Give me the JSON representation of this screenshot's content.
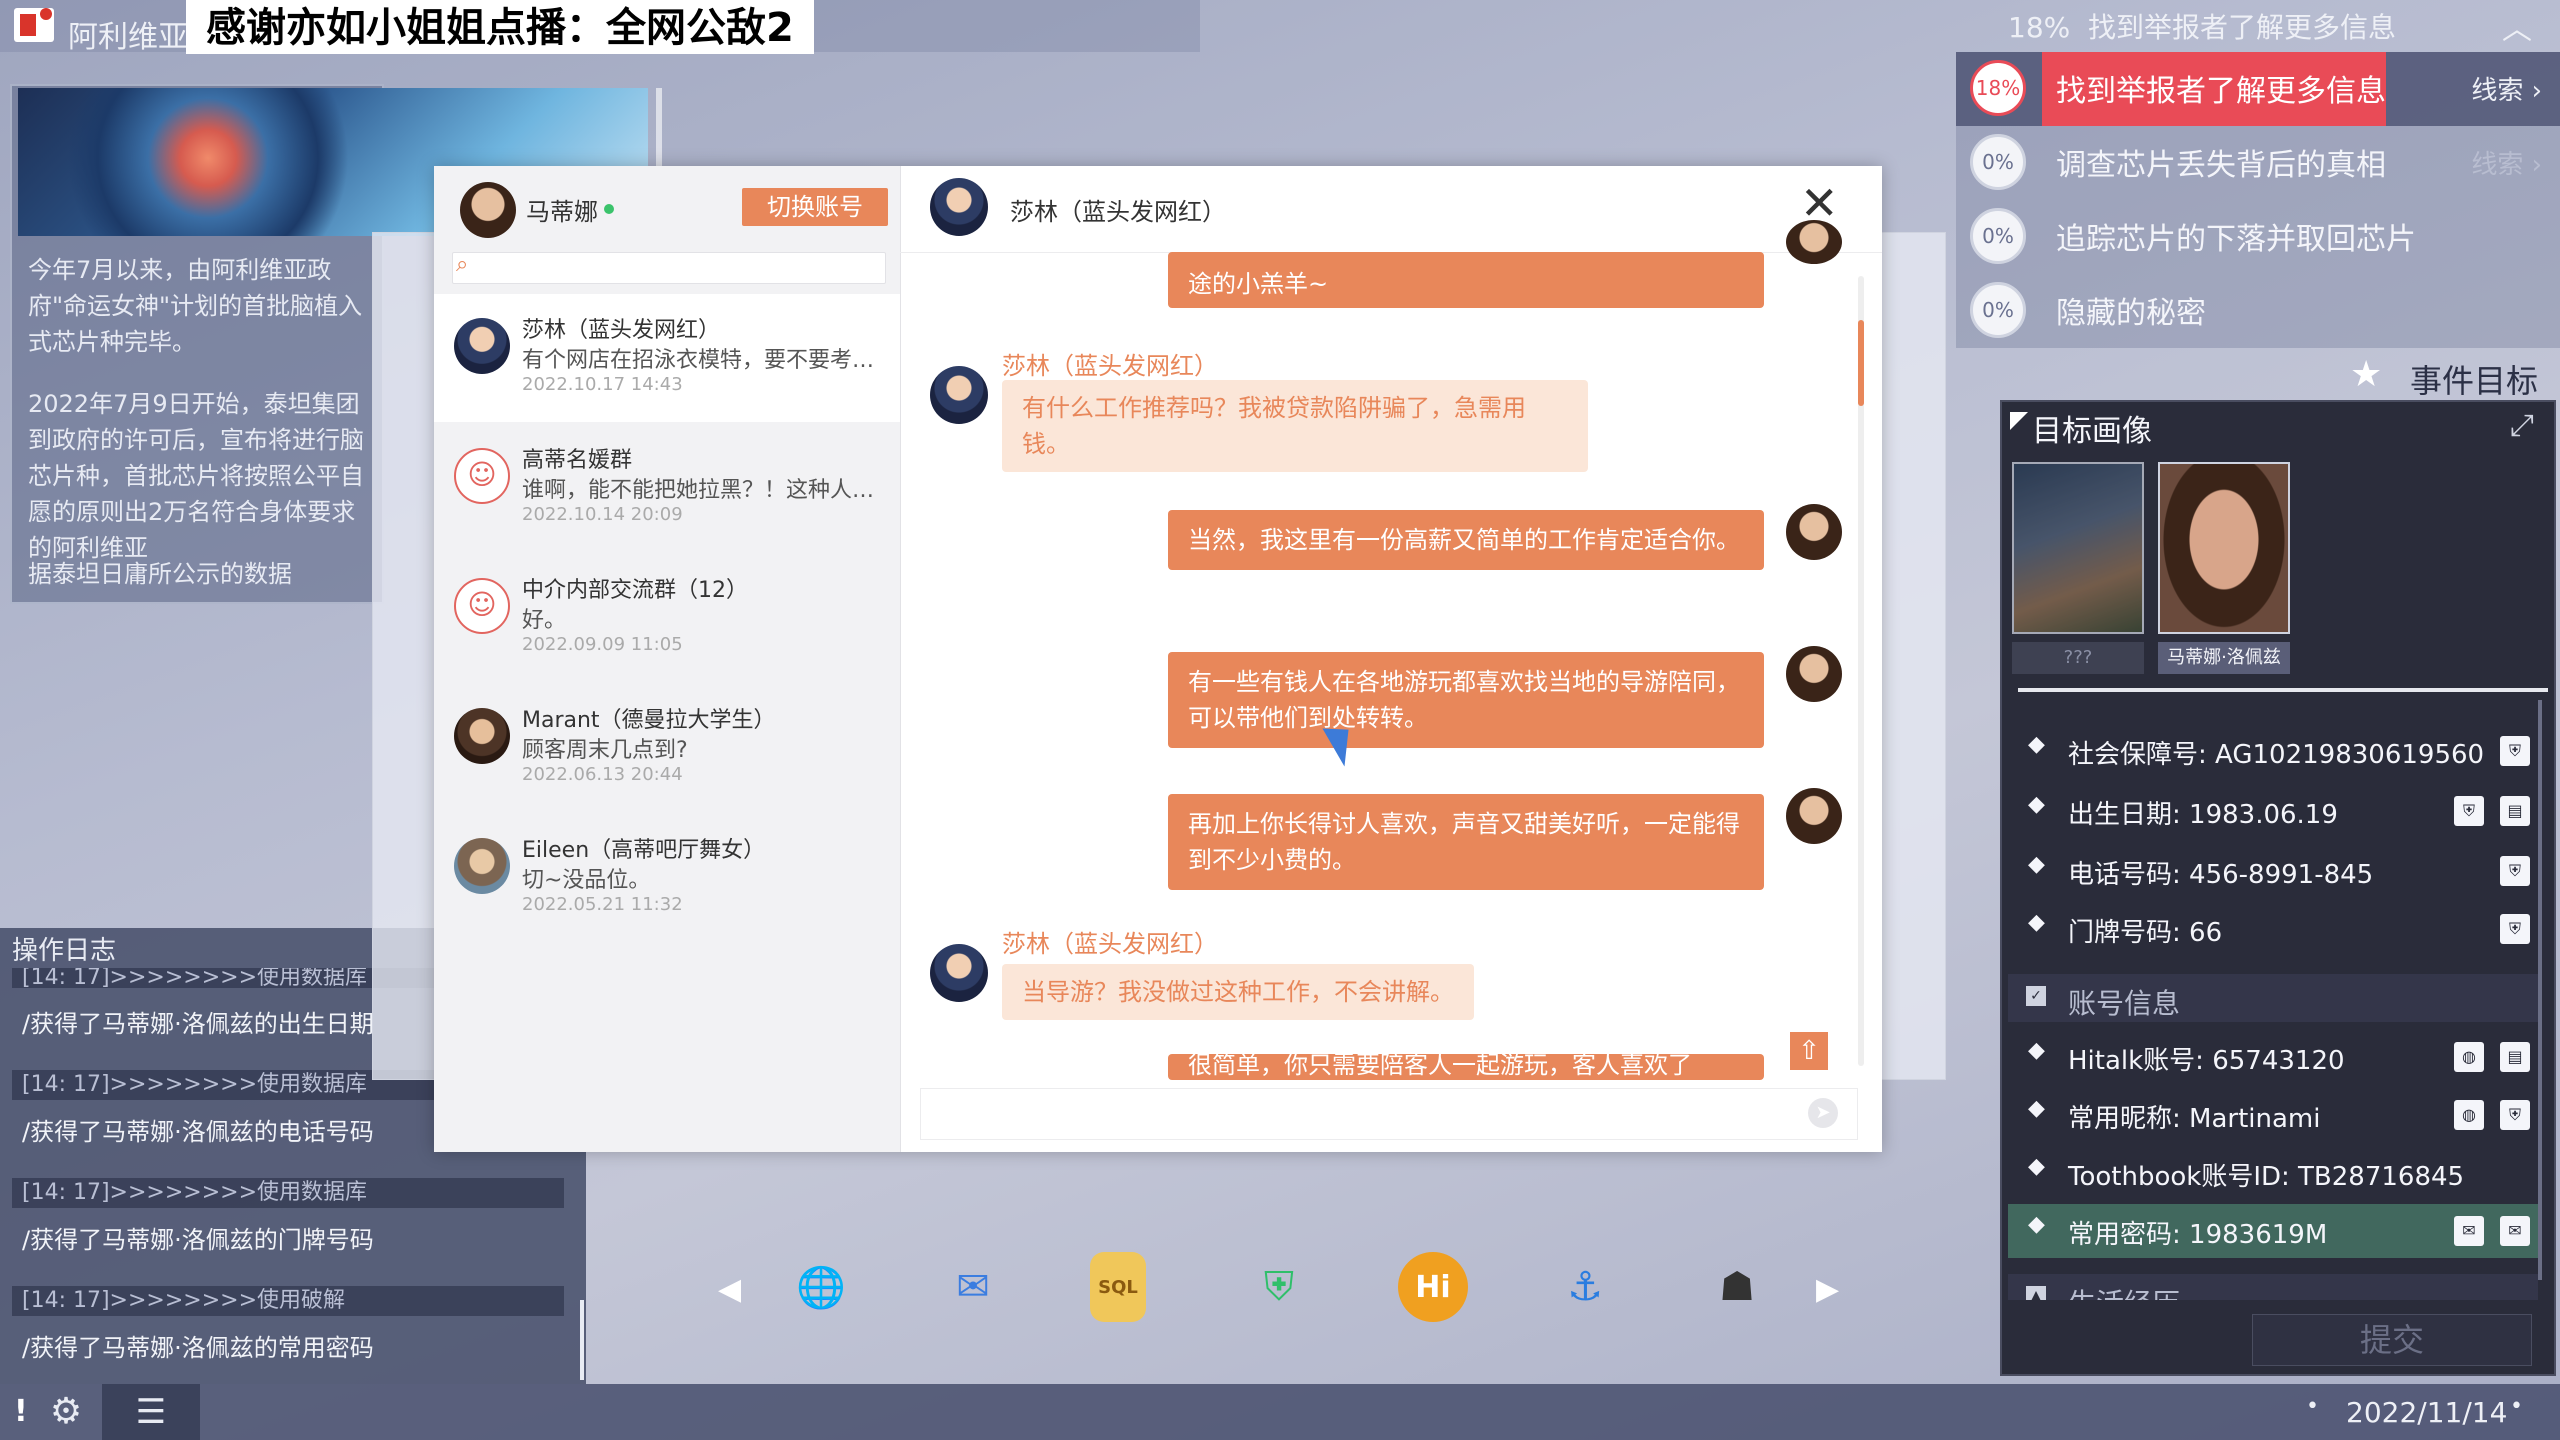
{
  "app": {
    "name": "阿利维亚"
  },
  "danmaku": "感谢亦如小姐姐点播：全网公敌2",
  "article": {
    "para1": "今年7月以来，由阿利维亚政府\"命运女神\"计划的首批脑植入式芯片种完毕。",
    "para2": "2022年7月9日开始，泰坦集团到政府的许可后，宣布将进行脑芯片种，首批芯片将按照公平自愿的原则出2万名符合身体要求的阿利维亚",
    "para3": "据泰坦日庸所公示的数据"
  },
  "oplog": {
    "title": "操作日志",
    "entries": [
      {
        "head": "[14: 17]>>>>>>>>使用数据库",
        "body": "/获得了马蒂娜·洛佩兹的出生日期"
      },
      {
        "head": "[14: 17]>>>>>>>>使用数据库",
        "body": "/获得了马蒂娜·洛佩兹的电话号码"
      },
      {
        "head": "[14: 17]>>>>>>>>使用数据库",
        "body": "/获得了马蒂娜·洛佩兹的门牌号码"
      },
      {
        "head": "[14: 17]>>>>>>>>使用破解",
        "body": "/获得了马蒂娜·洛佩兹的常用密码"
      }
    ]
  },
  "statusbar": {
    "alert": "!",
    "date": "2022/11/14",
    "dot": "•"
  },
  "dock": {
    "prev": "◀",
    "next": "▶",
    "icons": [
      {
        "name": "globe-app-icon",
        "glyph": "🌐",
        "color": "#3a8fd8"
      },
      {
        "name": "mail-app-icon",
        "glyph": "✉",
        "color": "#3b7de0"
      },
      {
        "name": "sql-app-icon",
        "glyph": "SQL",
        "color": "#e8b63a"
      },
      {
        "name": "shield-app-icon",
        "glyph": "⛨",
        "color": "#2fbf6a"
      },
      {
        "name": "hitalk-app-icon",
        "glyph": "Hi",
        "color": "#f0a020"
      },
      {
        "name": "fishhook-app-icon",
        "glyph": "⚓",
        "color": "#2a7de0"
      },
      {
        "name": "hacker-hi-app-icon",
        "glyph": "☗",
        "color": "#333333"
      }
    ]
  },
  "chat": {
    "me": {
      "name": "马蒂娜",
      "switch_label": "切换账号"
    },
    "search_icon": "⌕",
    "contacts": [
      {
        "name": "莎林（蓝头发网红）",
        "msg": "有个网店在招泳衣模特，要不要考虑一下？",
        "time": "2022.10.17  14:43"
      },
      {
        "name": "高蒂名媛群",
        "msg": "谁啊，能不能把她拉黑？！这种人也能进群？",
        "time": "2022.10.14  20:09"
      },
      {
        "name": "中介内部交流群（12）",
        "msg": "好。",
        "time": "2022.09.09  11:05"
      },
      {
        "name": "Marant（德曼拉大学生）",
        "msg": "顾客周末几点到?",
        "time": "2022.06.13  20:44"
      },
      {
        "name": "Eileen（高蒂吧厅舞女）",
        "msg": "切~没品位。",
        "time": "2022.05.21  11:32"
      }
    ],
    "group_glyph": "☺",
    "header": {
      "name": "莎林（蓝头发网红）",
      "close": "✕"
    },
    "messages": {
      "m0": "途的小羔羊~",
      "sender1": "莎林（蓝头发网红）",
      "m1": "有什么工作推荐吗？我被贷款陷阱骗了，急需用钱。",
      "m2": "当然，我这里有一份高薪又简单的工作肯定适合你。",
      "m3": "有一些有钱人在各地游玩都喜欢找当地的导游陪同，可以带他们到处转转。",
      "m4": "再加上你长得讨人喜欢，声音又甜美好听，一定能得到不少小费的。",
      "sender2": "莎林（蓝头发网红）",
      "m5": "当导游？我没做过这种工作，不会讲解。",
      "m6": "很简单，你只需要陪客人一起游玩，客人喜欢了"
    },
    "scroll_top": "⇧",
    "send": "➤"
  },
  "objectives": {
    "header_pct": "18%",
    "header_text": "找到举报者了解更多信息",
    "collapse": "︿",
    "items": [
      {
        "pct": "18%",
        "text": "找到举报者了解更多信息",
        "clue": "线索 ›"
      },
      {
        "pct": "0%",
        "text": "调查芯片丢失背后的真相",
        "clue": "线索 ›"
      },
      {
        "pct": "0%",
        "text": "追踪芯片的下落并取回芯片"
      },
      {
        "pct": "0%",
        "text": "隐藏的秘密"
      }
    ],
    "event_goal": "事件目标",
    "star": "★"
  },
  "profile": {
    "title": "目标画像",
    "expand": "⤢",
    "portrait1_label": "???",
    "portrait2_label": "马蒂娜·洛佩兹",
    "bullet": "◆",
    "info": [
      {
        "label": "社会保障号: AG10219830619560"
      },
      {
        "label": "出生日期: 1983.06.19"
      },
      {
        "label": "电话号码: 456-8991-845"
      },
      {
        "label": "门牌号码: 66"
      }
    ],
    "account_section": "账号信息",
    "accounts": [
      {
        "label": "Hitalk账号: 65743120"
      },
      {
        "label": "常用昵称: Martinami"
      },
      {
        "label": "Toothbook账号ID: TB28716845"
      },
      {
        "label": "常用密码: 1983619M"
      }
    ],
    "life_section": "生活经历",
    "submit": "提交"
  }
}
